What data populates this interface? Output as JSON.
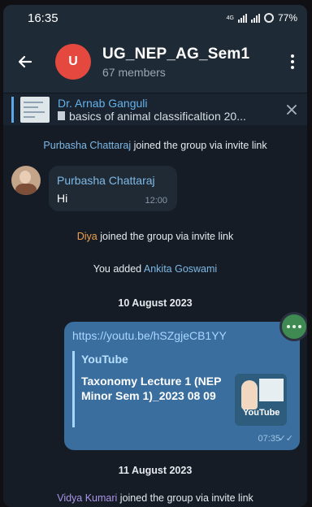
{
  "status_bar": {
    "time": "16:35",
    "network": "4G",
    "battery": "77%"
  },
  "header": {
    "avatar_letter": "U",
    "group_name": "UG_NEP_AG_Sem1",
    "members": "67 members"
  },
  "pinned": {
    "author": "Dr. Arnab Ganguli",
    "message": "basics of animal classificaltion 20..."
  },
  "messages": {
    "join1": {
      "name": "Purbasha Chattaraj",
      "text": " joined the group via invite link"
    },
    "incoming": {
      "sender": "Purbasha Chattaraj",
      "text": "Hi",
      "time": "12:00"
    },
    "join2": {
      "name": "Diya",
      "text": " joined the group via invite link"
    },
    "added": {
      "prefix": "You added ",
      "name": "Ankita Goswami"
    },
    "date1": "10 August 2023",
    "outgoing": {
      "link": "https://youtu.be/hSZgjeCB1YY",
      "site": "YouTube",
      "title": "Taxonomy Lecture 1 (NEP Minor Sem 1)_2023 08 09",
      "thumb_label": "YouTube",
      "time": "07:35"
    },
    "date2": "11 August 2023",
    "join3": {
      "name": "Vidya Kumari",
      "text": " joined the group via invite link"
    }
  },
  "colors": {
    "accent": "#64b2ea",
    "outgoing_bubble": "#3a6e9e",
    "avatar_red": "#e5483f"
  }
}
